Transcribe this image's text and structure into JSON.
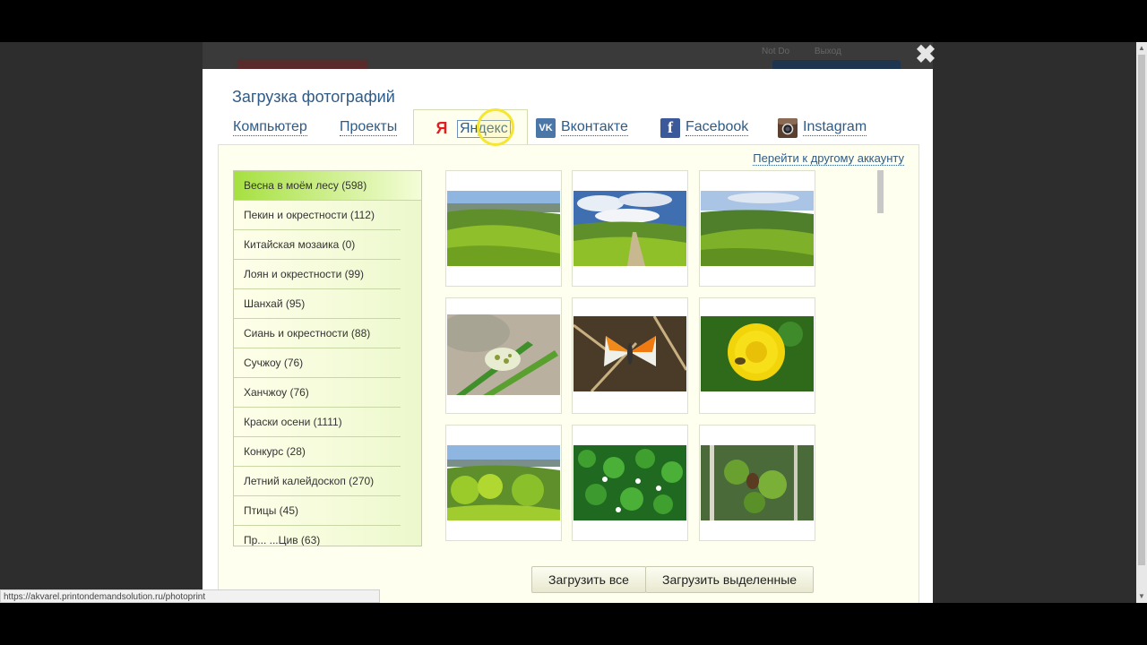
{
  "background": {
    "nav_items": [
      "Not Do",
      "Выход"
    ]
  },
  "modal": {
    "title": "Загрузка фотографий",
    "close_label": "✖",
    "tabs": [
      {
        "label": "Компьютер",
        "icon": null,
        "active": false
      },
      {
        "label": "Проекты",
        "icon": null,
        "active": false
      },
      {
        "label": "Яндекс",
        "icon": "yandex-icon",
        "active": true
      },
      {
        "label": "Вконтакте",
        "icon": "vk-icon",
        "active": false
      },
      {
        "label": "Facebook",
        "icon": "facebook-icon",
        "active": false
      },
      {
        "label": "Instagram",
        "icon": "instagram-icon",
        "active": false
      }
    ],
    "switch_account": "Перейти к другому аккаунту",
    "albums": [
      "Весна в моём лесу (598)",
      "Пекин и окрестности (112)",
      "Китайская мозаика (0)",
      "Лоян и окрестности (99)",
      "Шанхай (95)",
      "Сиань и окрестности (88)",
      "Сучжоу (76)",
      "Ханчжоу (76)",
      "Краски осени (1111)",
      "Конкурс (28)",
      "Летний калейдоскоп (270)",
      "Птицы (45)",
      "Пр... ...Цив (63)"
    ],
    "photos": [
      "landscape-green-hills-1",
      "landscape-clouds-path",
      "landscape-green-hills-2",
      "butterfly-on-grass",
      "butterfly-orange-tip",
      "dandelion-with-bee",
      "landscape-spring-trees",
      "wood-sorrel-flowers",
      "green-branch-cone"
    ],
    "buttons": {
      "upload_all": "Загрузить все",
      "upload_selected": "Загрузить выделенные"
    }
  },
  "status_url": "https://akvarel.printondemandsolution.ru/photoprint",
  "colors": {
    "link": "#2f5b87",
    "active_album": "#a6e040",
    "panel": "#fffff0"
  }
}
